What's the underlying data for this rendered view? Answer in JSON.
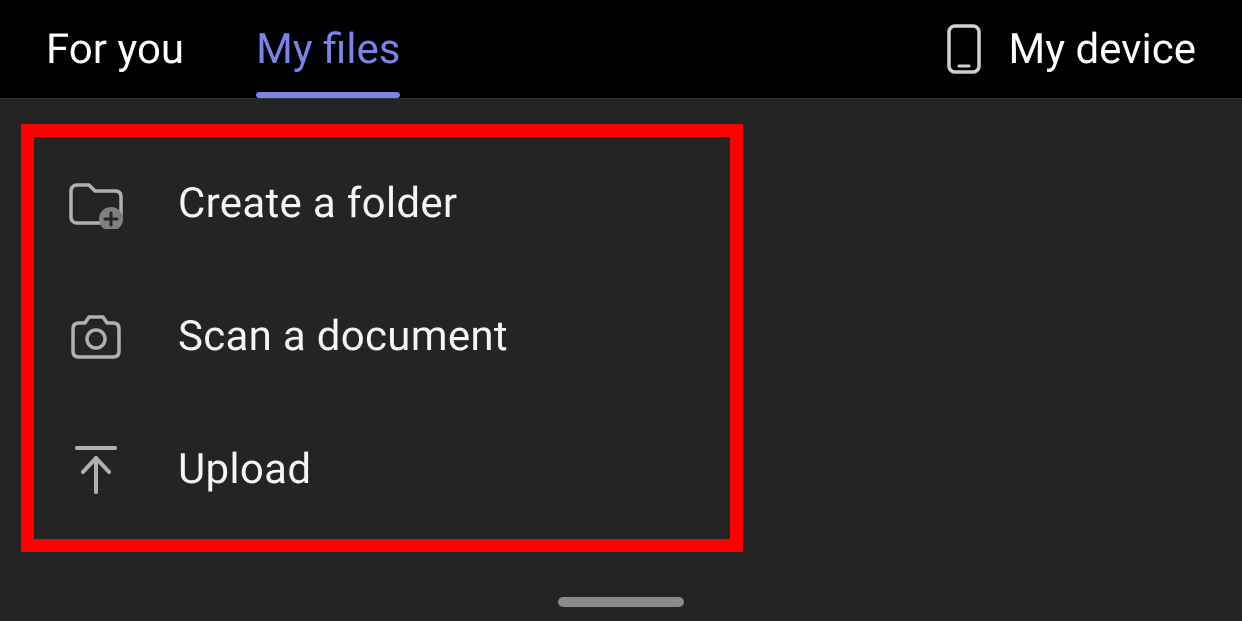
{
  "tabs": {
    "for_you": "For you",
    "my_files": "My files"
  },
  "device_link": {
    "label": "My device"
  },
  "menu": {
    "create_folder": {
      "label": "Create a folder"
    },
    "scan_document": {
      "label": "Scan a document"
    },
    "upload": {
      "label": "Upload"
    }
  },
  "highlight": {
    "color": "#ff0000"
  },
  "colors": {
    "accent": "#7b83eb",
    "sheet_bg": "#242424",
    "icon": "#b0b0b0",
    "text": "#f5f5f5"
  }
}
